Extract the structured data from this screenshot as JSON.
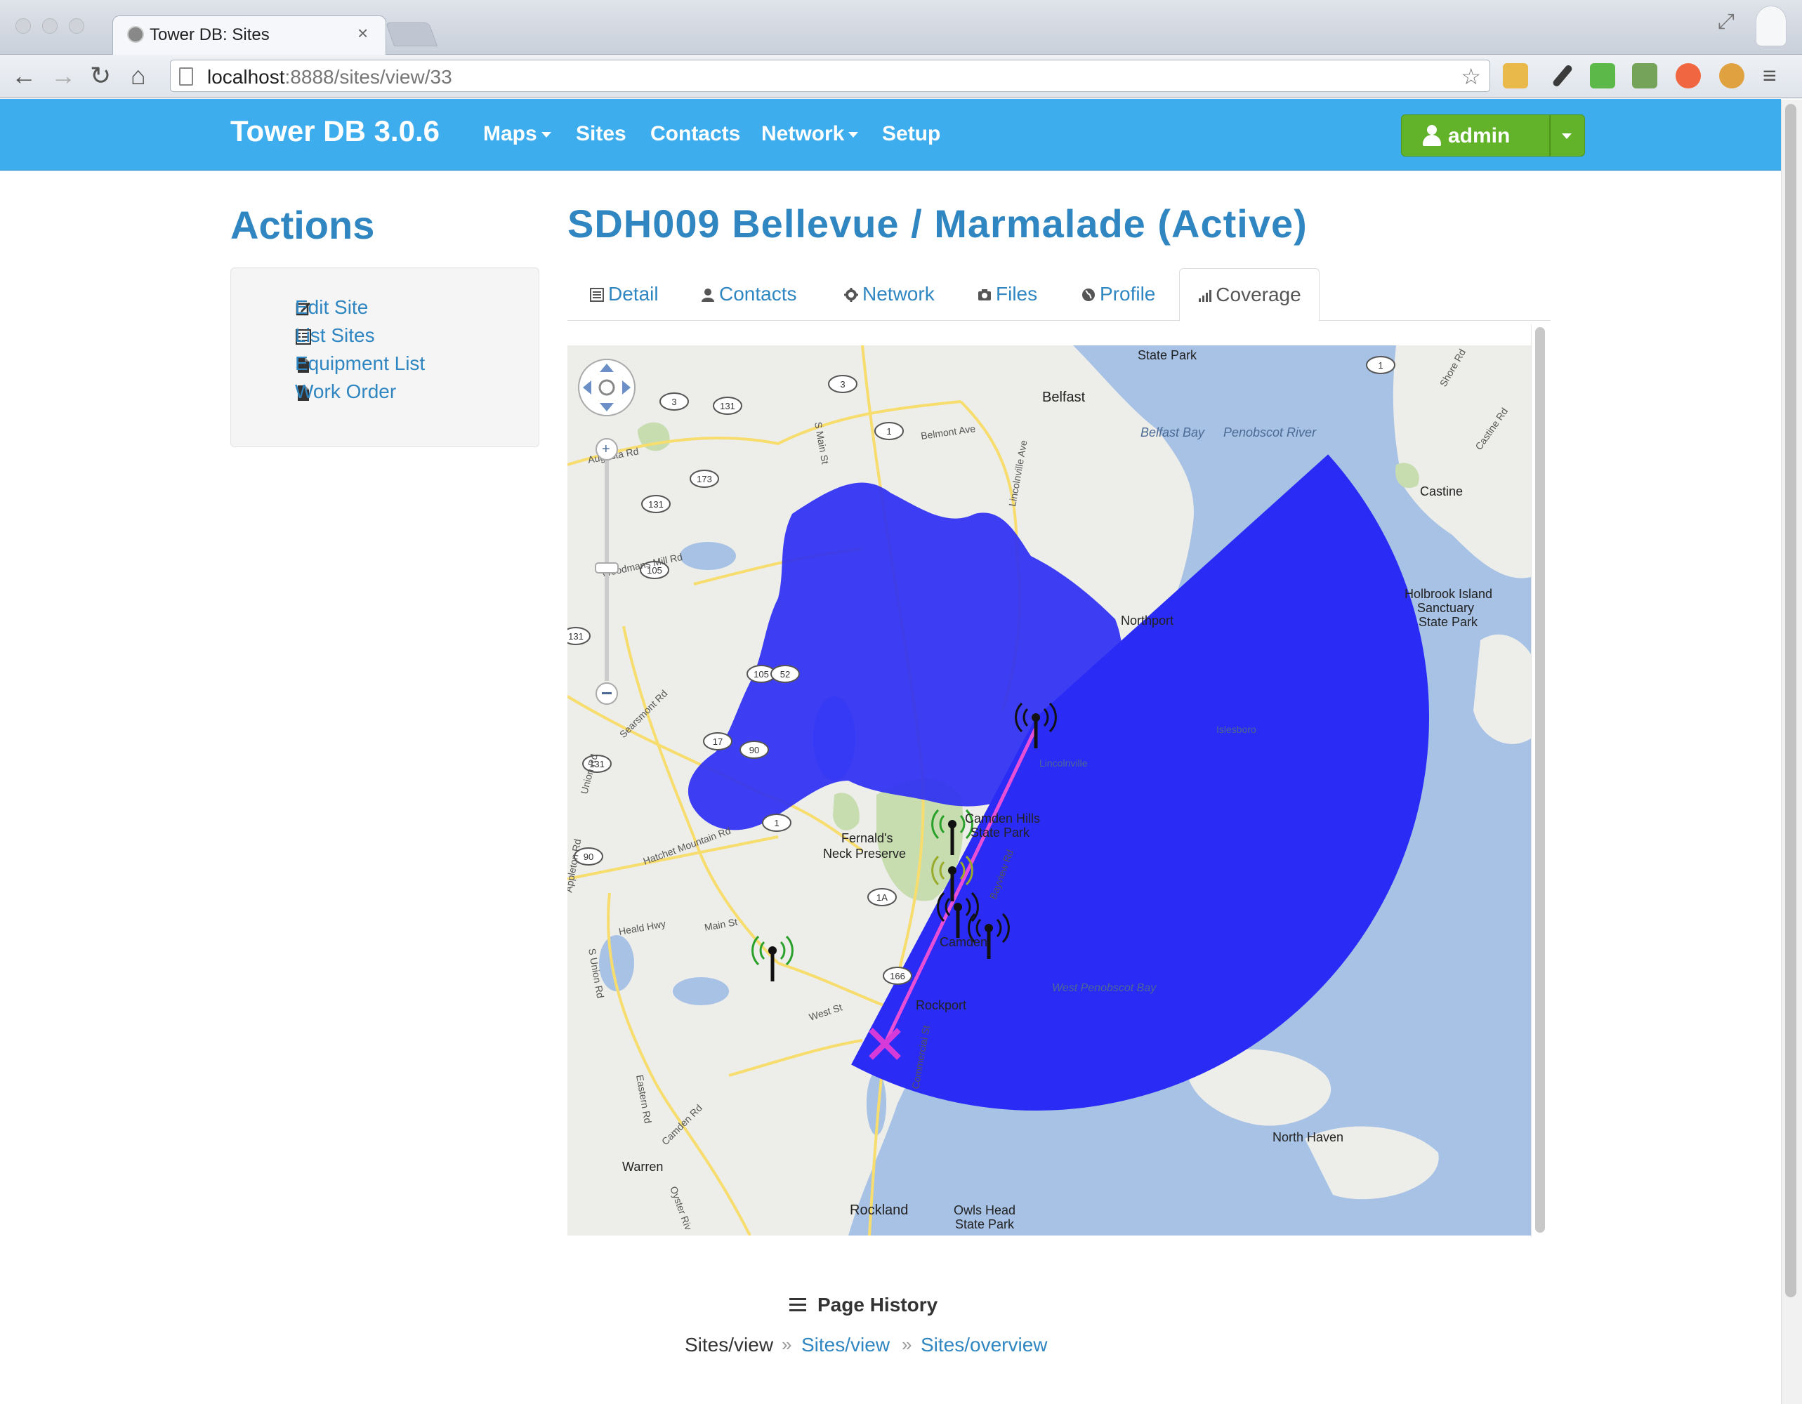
{
  "browser": {
    "tab_title": "Tower DB: Sites",
    "url_host": "localhost",
    "url_rest": ":8888/sites/view/33"
  },
  "navbar": {
    "brand": "Tower DB 3.0.6",
    "links": [
      {
        "label": "Maps",
        "dropdown": true
      },
      {
        "label": "Sites",
        "dropdown": false
      },
      {
        "label": "Contacts",
        "dropdown": false
      },
      {
        "label": "Network",
        "dropdown": true
      },
      {
        "label": "Setup",
        "dropdown": false
      }
    ],
    "user_label": "admin",
    "colors": {
      "bar": "#3daded",
      "user_button": "#62b22a"
    }
  },
  "sidebar": {
    "heading": "Actions",
    "items": [
      {
        "label": "Edit Site",
        "icon": "edit-icon"
      },
      {
        "label": "List Sites",
        "icon": "list-icon"
      },
      {
        "label": "Equipment List",
        "icon": "file-icon"
      },
      {
        "label": "Work Order",
        "icon": "file-icon"
      }
    ]
  },
  "main": {
    "title": "SDH009 Bellevue / Marmalade (Active)",
    "tabs": [
      {
        "label": "Detail",
        "icon": "list-icon"
      },
      {
        "label": "Contacts",
        "icon": "user-icon"
      },
      {
        "label": "Network",
        "icon": "gear-icon"
      },
      {
        "label": "Files",
        "icon": "camera-icon"
      },
      {
        "label": "Profile",
        "icon": "globe-icon"
      },
      {
        "label": "Coverage",
        "icon": "signal-icon",
        "active": true
      }
    ]
  },
  "map": {
    "labels": {
      "state_park_top": "State Park",
      "belfast": "Belfast",
      "belfast_bay": "Belfast Bay",
      "penobscot_river": "Penobscot River",
      "castine": "Castine",
      "holbrook_1": "Holbrook Island",
      "holbrook_2": "Sanctuary",
      "holbrook_3": "State Park",
      "northport": "Northport",
      "fernalds_1": "Fernald's",
      "fernalds_2": "Neck Preserve",
      "camden_hills_1": "Camden Hills",
      "camden_hills_2": "State Park",
      "camden": "Camden",
      "rockport": "Rockport",
      "north_haven": "North Haven",
      "warren": "Warren",
      "rockland": "Rockland",
      "owls_head_1": "Owls Head",
      "owls_head_2": "State Park",
      "west_penobscot_bay": "West Penobscot Bay",
      "islesboro": "Islesboro",
      "lincolnville": "Lincolnville",
      "belmont_ave": "Belmont Ave",
      "augusta_rd": "Augusta Rd",
      "woodmans_mill_rd": "Woodmans Mill Rd",
      "searsmont_rd": "Searsmont Rd",
      "union_rd": "Union Rd",
      "hatchet_mountain_rd": "Hatchet Mountain Rd",
      "heald_hwy": "Heald Hwy",
      "main_st": "Main St",
      "west_st": "West St",
      "commercial_st": "Commercial St",
      "camden_rd": "Camden Rd",
      "eastern_rd": "Eastern Rd",
      "oyster_riv": "Oyster Riv",
      "bayview_rd": "Bayview Rd",
      "shore_rd": "Shore Rd",
      "castine_rd": "Castine Rd",
      "s_main_st": "S Main St",
      "lincolnville_ave": "Lincolnville Ave",
      "s_union_rd": "S Union Rd",
      "appleton_rd": "Appleton Rd"
    },
    "route_shields": [
      "3",
      "131",
      "3",
      "1",
      "173",
      "131",
      "105",
      "131",
      "105",
      "52",
      "17",
      "90",
      "131",
      "90",
      "1",
      "1A",
      "1",
      "166"
    ],
    "colors": {
      "water": "#a7c2e5",
      "land": "#ededea",
      "park": "#c7ddb0",
      "coverage": "#2a2bf5",
      "link": "#e84fd7",
      "target": "#d63ad8"
    }
  },
  "footer": {
    "history_title": "Page History",
    "crumbs": [
      {
        "label": "Sites/view",
        "link": false
      },
      {
        "label": "Sites/view",
        "link": true
      },
      {
        "label": "Sites/overview",
        "link": true
      }
    ]
  }
}
